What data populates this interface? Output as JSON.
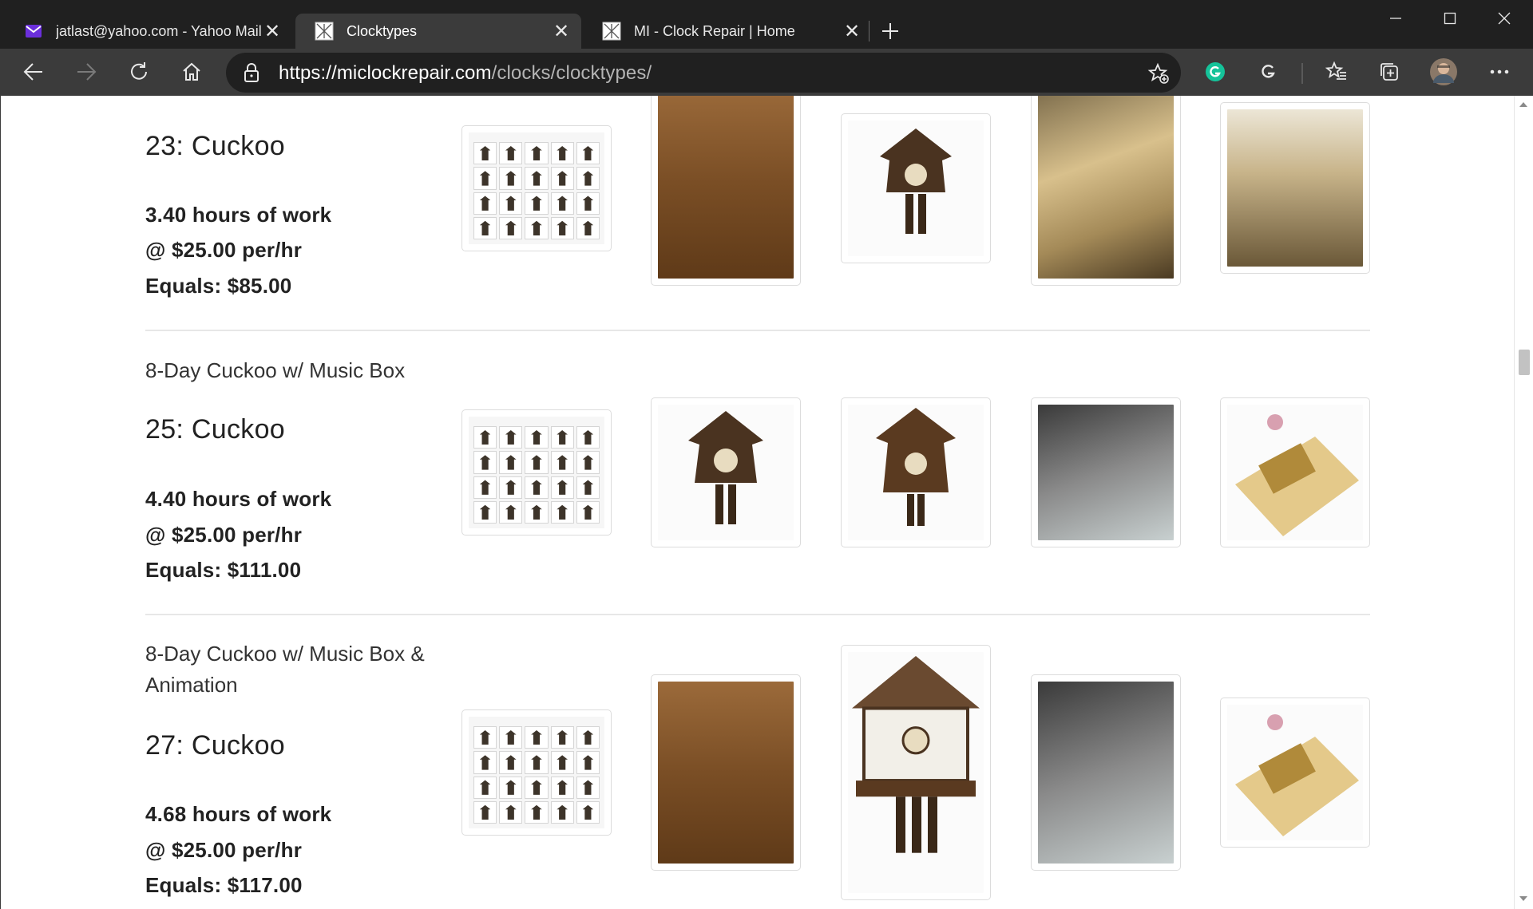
{
  "browser": {
    "tabs": [
      {
        "title": "jatlast@yahoo.com - Yahoo Mail",
        "favicon": "envelope-icon"
      },
      {
        "title": "Clocktypes",
        "favicon": "clock-site-icon"
      },
      {
        "title": "MI - Clock Repair | Home",
        "favicon": "clock-site-icon"
      }
    ],
    "address": {
      "host": "https://miclockrepair.com",
      "path": "/clocks/clocktypes/"
    }
  },
  "page": {
    "sections": [
      {
        "subtitle": "",
        "heading": "23: Cuckoo",
        "hours": "3.40 hours of work",
        "rate": "@ $25.00 per/hr",
        "total": "Equals: $85.00"
      },
      {
        "subtitle": "8-Day Cuckoo w/ Music Box",
        "heading": "25: Cuckoo",
        "hours": "4.40 hours of work",
        "rate": "@ $25.00 per/hr",
        "total": "Equals: $111.00"
      },
      {
        "subtitle": "8-Day Cuckoo w/ Music Box & Animation",
        "heading": "27: Cuckoo",
        "hours": "4.68 hours of work",
        "rate": "@ $25.00 per/hr",
        "total": "Equals: $117.00"
      }
    ]
  },
  "colors": {
    "accent_grammarly": "#15c39a",
    "tab_bg": "#202020",
    "toolbar_bg": "#3b3b3b"
  }
}
